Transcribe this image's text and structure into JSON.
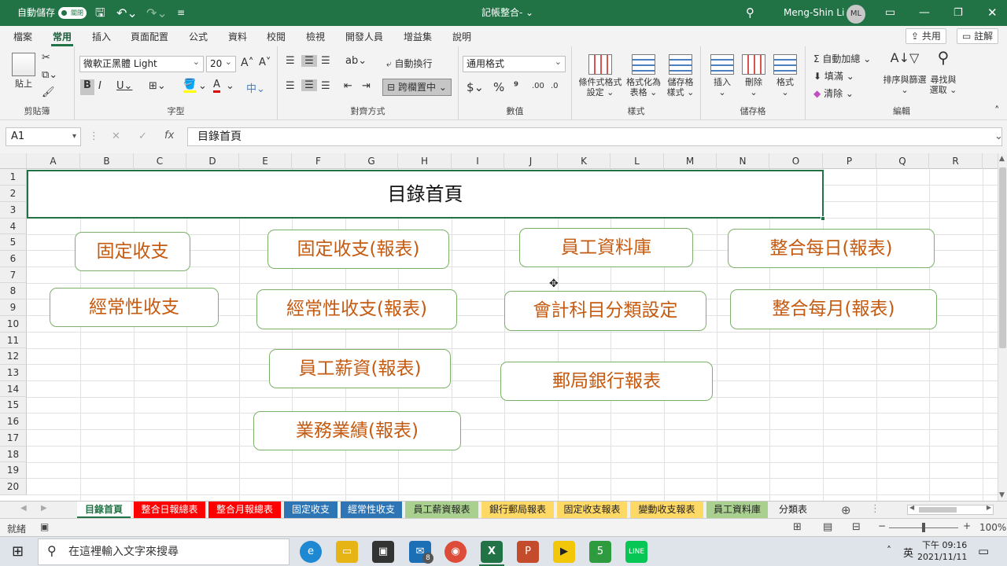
{
  "title_bar": {
    "autosave_label": "自動儲存",
    "autosave_state": "關閉",
    "file_title": "記帳整合-",
    "user": "Meng-Shin Li",
    "avatar_initials": "ML"
  },
  "ribbon_tabs": [
    "檔案",
    "常用",
    "插入",
    "頁面配置",
    "公式",
    "資料",
    "校閱",
    "檢視",
    "開發人員",
    "增益集",
    "說明"
  ],
  "share_label": "共用",
  "comment_label": "註解",
  "ribbon": {
    "clipboard": {
      "label": "剪貼簿",
      "paste": "貼上"
    },
    "font": {
      "label": "字型",
      "font_name": "微軟正黑體 Light",
      "font_size": "20"
    },
    "alignment": {
      "label": "對齊方式",
      "wrap_text": "自動換行",
      "merge_center": "跨欄置中"
    },
    "number": {
      "label": "數值",
      "format": "通用格式"
    },
    "styles": {
      "label": "樣式",
      "conditional_line1": "條件式格式",
      "conditional_line2": "設定",
      "format_table_line1": "格式化為",
      "format_table_line2": "表格",
      "cell_styles_line1": "儲存格",
      "cell_styles_line2": "樣式"
    },
    "cells": {
      "label": "儲存格",
      "insert": "插入",
      "delete": "刪除",
      "format": "格式"
    },
    "editing": {
      "label": "編輯",
      "autosum": "自動加總",
      "fill": "填滿",
      "clear": "清除",
      "sort_line1": "排序與篩選",
      "find_line1": "尋找與",
      "find_line2": "選取"
    }
  },
  "formula_bar": {
    "name_box": "A1",
    "content": "目錄首頁"
  },
  "columns": [
    "A",
    "B",
    "C",
    "D",
    "E",
    "F",
    "G",
    "H",
    "I",
    "J",
    "K",
    "L",
    "M",
    "N",
    "O",
    "P",
    "Q",
    "R"
  ],
  "rows": [
    "1",
    "2",
    "3",
    "4",
    "5",
    "6",
    "7",
    "8",
    "9",
    "10",
    "11",
    "12",
    "13",
    "14",
    "15",
    "16",
    "17",
    "18",
    "19",
    "20"
  ],
  "title_cell": "目錄首頁",
  "buttons": {
    "fixed_income": "固定收支",
    "fixed_income_report": "固定收支(報表)",
    "employee_db": "員工資料庫",
    "daily_report": "整合每日(報表)",
    "regular_income": "經常性收支",
    "regular_income_report": "經常性收支(報表)",
    "account_setting": "會計科目分類設定",
    "monthly_report": "整合每月(報表)",
    "salary_report": "員工薪資(報表)",
    "post_bank_report": "郵局銀行報表",
    "performance_report": "業務業績(報表)"
  },
  "sheet_tabs": [
    {
      "label": "目錄首頁",
      "color": "#ffffff"
    },
    {
      "label": "整合日報總表",
      "color": "#ff0000"
    },
    {
      "label": "整合月報總表",
      "color": "#ff0000"
    },
    {
      "label": "固定收支",
      "color": "#2e75b6"
    },
    {
      "label": "經常性收支",
      "color": "#2e75b6"
    },
    {
      "label": "員工薪資報表",
      "color": "#a9d08e"
    },
    {
      "label": "銀行郵局報表",
      "color": "#ffd966"
    },
    {
      "label": "固定收支報表",
      "color": "#ffd966"
    },
    {
      "label": "變動收支報表",
      "color": "#ffd966"
    },
    {
      "label": "員工資料庫",
      "color": "#a9d08e"
    },
    {
      "label": "分類表",
      "color": "#f0f0f0"
    }
  ],
  "status": {
    "ready": "就緒",
    "zoom": "100%"
  },
  "taskbar": {
    "search_placeholder": "在這裡輸入文字來搜尋",
    "ime": "英",
    "time": "下午 09:16",
    "date": "2021/11/11",
    "mail_badge": "8"
  }
}
